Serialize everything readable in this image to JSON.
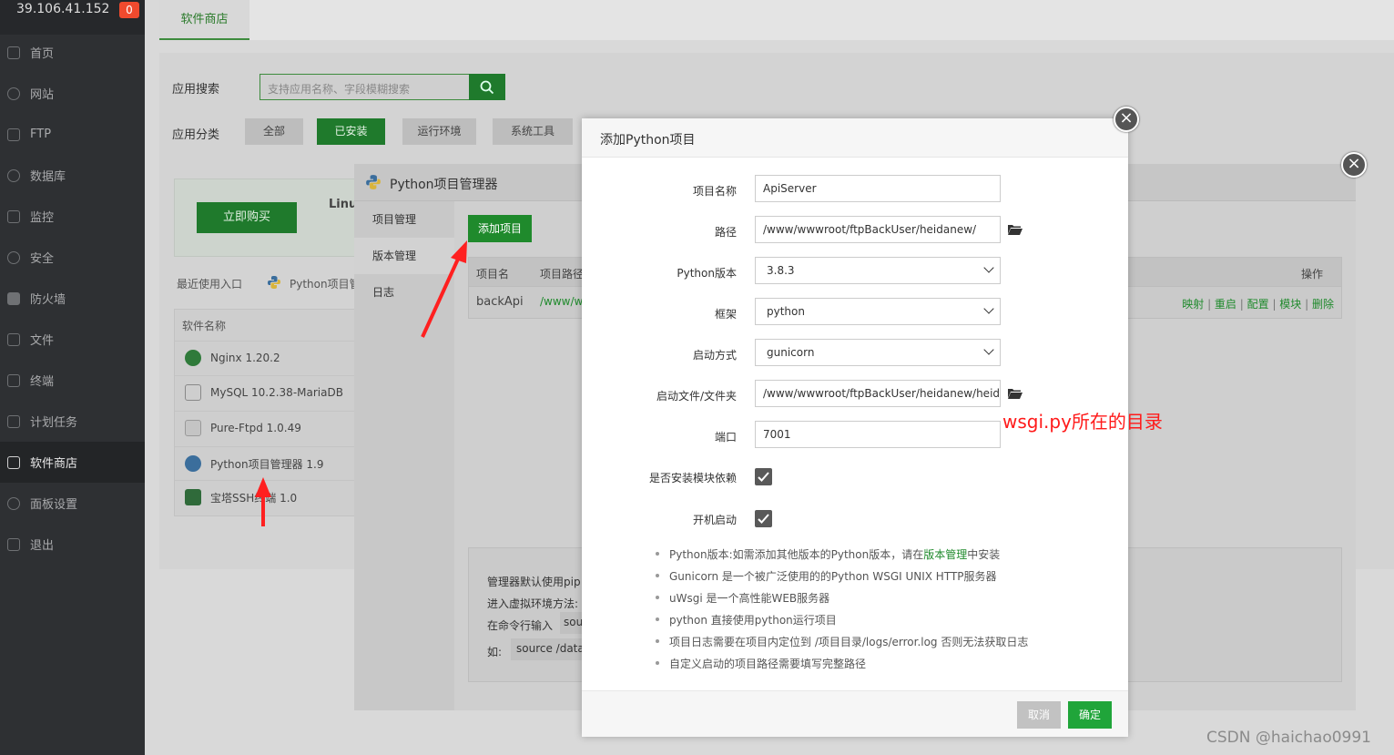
{
  "sidebar": {
    "ip": "39.106.41.152",
    "badge": "0",
    "items": [
      {
        "label": "首页",
        "icon": "home-icon"
      },
      {
        "label": "网站",
        "icon": "globe-icon"
      },
      {
        "label": "FTP",
        "icon": "ftp-icon"
      },
      {
        "label": "数据库",
        "icon": "database-icon"
      },
      {
        "label": "监控",
        "icon": "monitor-icon"
      },
      {
        "label": "安全",
        "icon": "shield-icon"
      },
      {
        "label": "防火墙",
        "icon": "firewall-icon"
      },
      {
        "label": "文件",
        "icon": "folder-icon"
      },
      {
        "label": "终端",
        "icon": "terminal-icon"
      },
      {
        "label": "计划任务",
        "icon": "calendar-icon"
      },
      {
        "label": "软件商店",
        "icon": "grid-icon"
      },
      {
        "label": "面板设置",
        "icon": "gear-icon"
      },
      {
        "label": "退出",
        "icon": "logout-icon"
      }
    ]
  },
  "tabs": {
    "active": "软件商店"
  },
  "store": {
    "search_label": "应用搜索",
    "search_placeholder": "支持应用名称、字段模糊搜索",
    "category_label": "应用分类",
    "categories": [
      "全部",
      "已安装",
      "运行环境",
      "系统工具"
    ],
    "buy_label": "立即购买",
    "ad_text": "Linu",
    "recent_label": "最近使用入口",
    "recent_item": "Python项目管",
    "table_header": "软件名称",
    "software": [
      "Nginx 1.20.2",
      "MySQL 10.2.38-MariaDB",
      "Pure-Ftpd 1.0.49",
      "Python项目管理器 1.9",
      "宝塔SSH终端 1.0"
    ]
  },
  "pm": {
    "title": "Python项目管理器",
    "menu": [
      "项目管理",
      "版本管理",
      "日志"
    ],
    "add_label": "添加项目",
    "col_name": "项目名",
    "col_path": "项目路径",
    "col_op": "操作",
    "row_name": "backApi",
    "row_path": "/www/w",
    "ops": [
      "映射",
      "重启",
      "配置",
      "模块",
      "删除"
    ],
    "note": [
      "管理器默认使用pip",
      "进入虚拟环境方法:",
      "在命令行输入",
      "如:"
    ],
    "note_code1": "sou",
    "note_code2": "source /data"
  },
  "modal": {
    "title": "添加Python项目",
    "labels": {
      "name": "项目名称",
      "path": "路径",
      "version": "Python版本",
      "framework": "框架",
      "startup": "启动方式",
      "startfile": "启动文件/文件夹",
      "port": "端口",
      "install_deps": "是否安装模块依赖",
      "autostart": "开机启动"
    },
    "values": {
      "name": "ApiServer",
      "path": "/www/wwwroot/ftpBackUser/heidanew/",
      "version": "3.8.3",
      "framework": "python",
      "startup": "gunicorn",
      "startfile": "/www/wwwroot/ftpBackUser/heidanew/heid",
      "port": "7001"
    },
    "tips": [
      {
        "pre": "Python版本:如需添加其他版本的Python版本，请在",
        "link": "版本管理",
        "post": "中安装"
      },
      {
        "pre": "Gunicorn 是一个被广泛使用的的Python WSGI UNIX HTTP服务器",
        "link": "",
        "post": ""
      },
      {
        "pre": "uWsgi 是一个高性能WEB服务器",
        "link": "",
        "post": ""
      },
      {
        "pre": "python 直接使用python运行项目",
        "link": "",
        "post": ""
      },
      {
        "pre": "项目日志需要在项目内定位到 /项目目录/logs/error.log 否则无法获取日志",
        "link": "",
        "post": ""
      },
      {
        "pre": "自定义启动的项目路径需要填写完整路径",
        "link": "",
        "post": ""
      }
    ],
    "cancel": "取消",
    "confirm": "确定"
  },
  "annotation": "wsgi.py所在的目录",
  "watermark": "CSDN @haichao0991",
  "colors": {
    "brand": "#1f8a2c",
    "annotation": "#ff1a1a"
  }
}
